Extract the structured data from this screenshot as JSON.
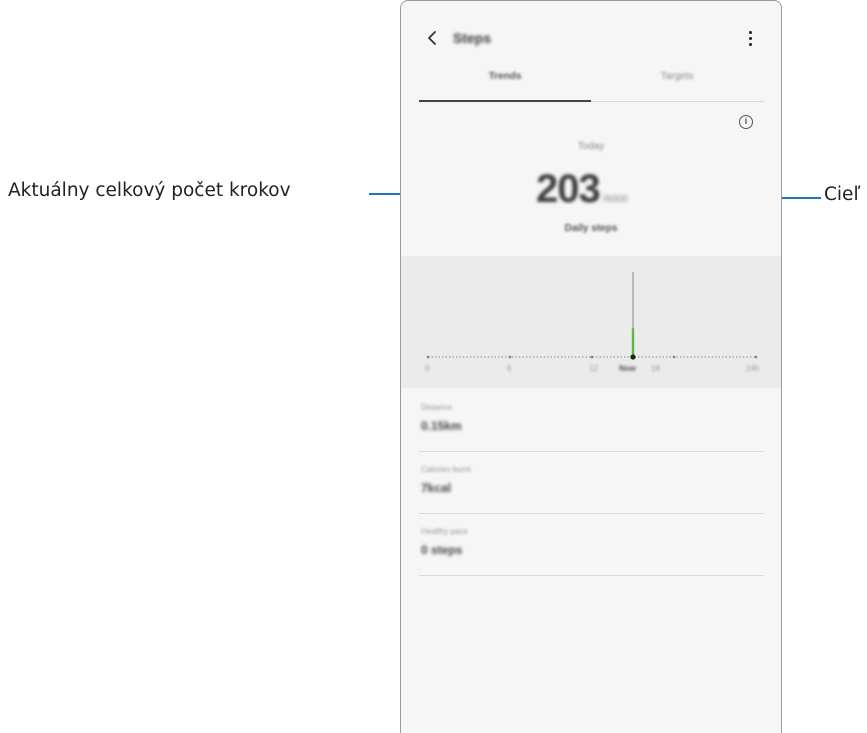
{
  "callouts": {
    "left": "Aktuálny celkový počet krokov",
    "right": "Cieľ"
  },
  "app": {
    "title": "Steps",
    "back_icon": "chevron-left-icon",
    "more_icon": "more-vertical-icon"
  },
  "tabs": [
    {
      "label": "Trends",
      "selected": true
    },
    {
      "label": "Targets",
      "selected": false
    }
  ],
  "summary": {
    "period_label": "Today",
    "step_count": "203",
    "target": "/6000",
    "caption": "Daily steps"
  },
  "chart_data": {
    "type": "bar",
    "x_tick_labels": [
      "0",
      "6",
      "12",
      "Now",
      "18",
      "24h"
    ],
    "current_time_marker": "Now",
    "series": [
      {
        "x_hour": 15,
        "value": 203
      }
    ],
    "accent_color": "#5cb845"
  },
  "stats": [
    {
      "label": "Distance",
      "value": "0.15km"
    },
    {
      "label": "Calories burnt",
      "value": "7kcal"
    },
    {
      "label": "Healthy pace",
      "value": "0 steps"
    }
  ],
  "colors": {
    "callout_line": "#1d7ab8",
    "chart_bar": "#5cb845",
    "panel_bg": "#f6f6f6"
  }
}
